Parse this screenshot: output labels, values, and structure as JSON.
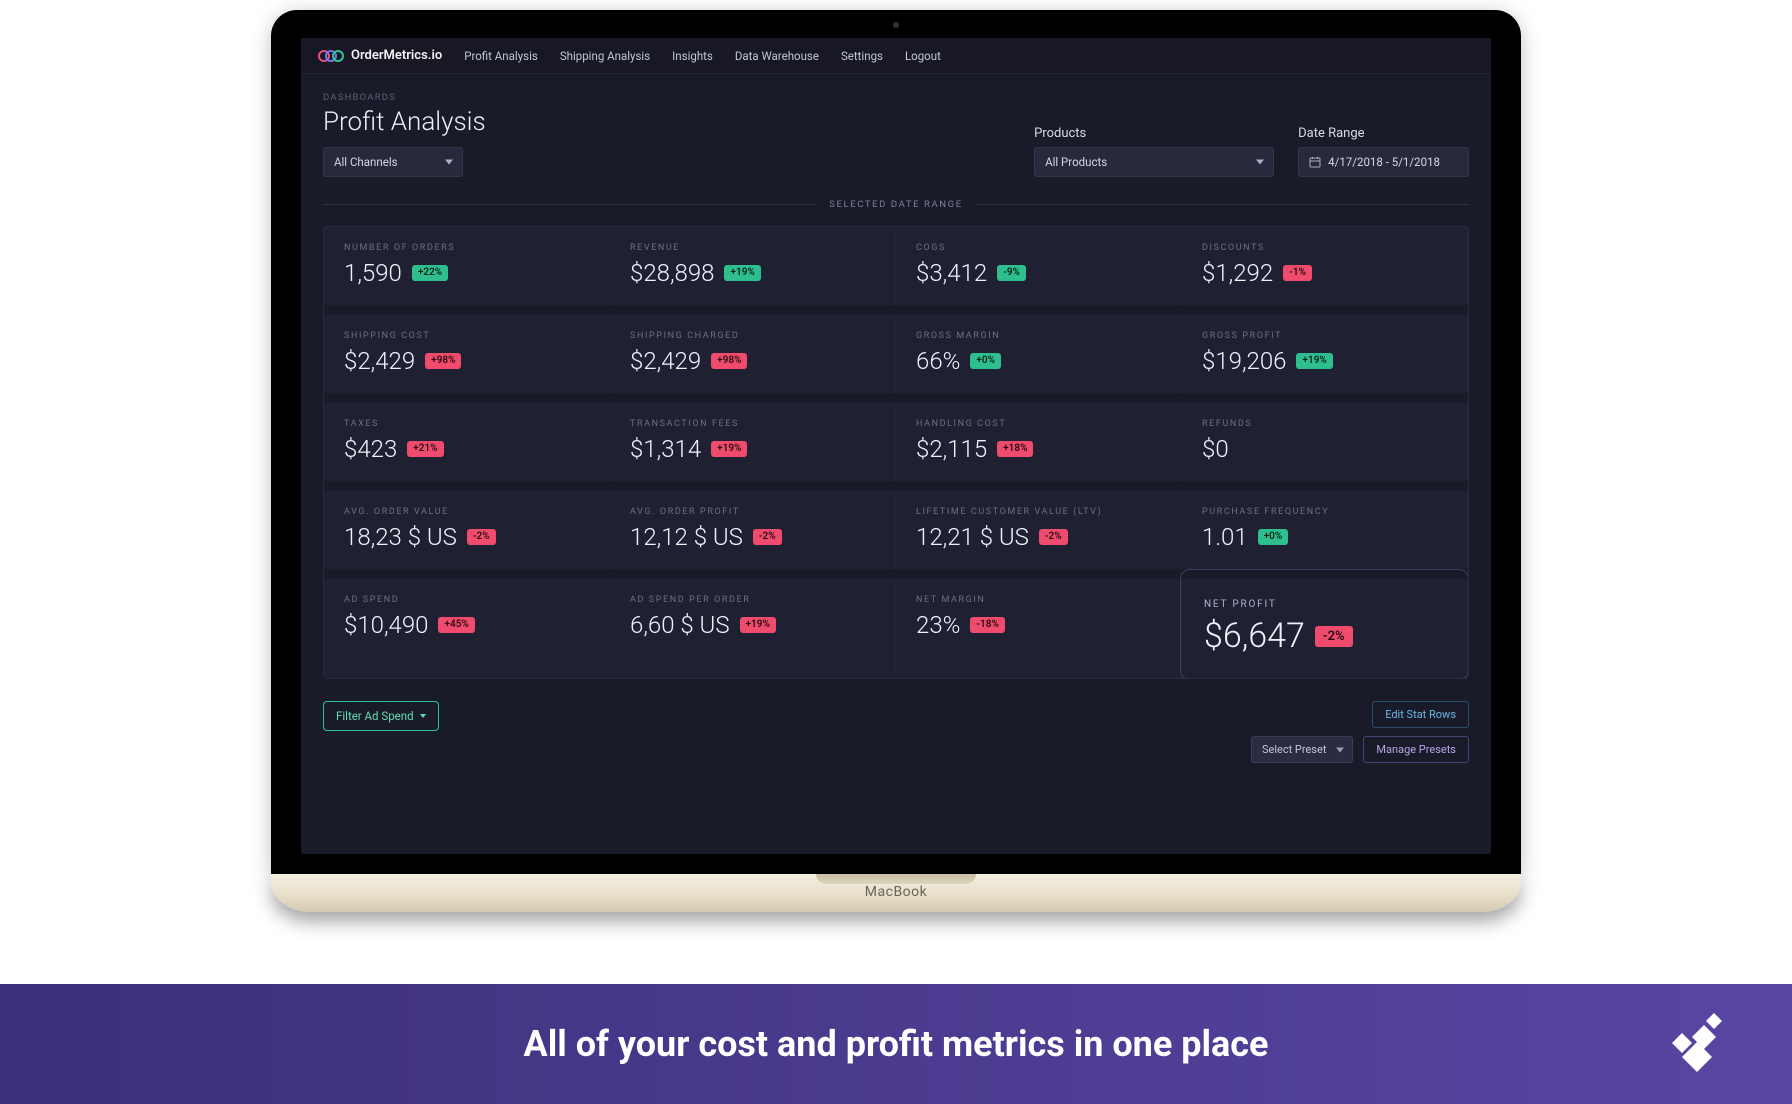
{
  "brand": {
    "name": "OrderMetrics.io",
    "laptop": "MacBook"
  },
  "nav": {
    "items": [
      {
        "label": "Profit Analysis"
      },
      {
        "label": "Shipping Analysis"
      },
      {
        "label": "Insights"
      },
      {
        "label": "Data Warehouse"
      },
      {
        "label": "Settings"
      },
      {
        "label": "Logout"
      }
    ]
  },
  "header": {
    "breadcrumb": "DASHBOARDS",
    "title": "Profit Analysis",
    "channel_select": "All Channels",
    "products_label": "Products",
    "products_select": "All Products",
    "date_label": "Date Range",
    "date_value": "4/17/2018 - 5/1/2018"
  },
  "divider": "SELECTED DATE RANGE",
  "metrics": [
    [
      {
        "label": "Number of Orders",
        "value": "1,590",
        "delta": "+22%",
        "dir": "up"
      },
      {
        "label": "Revenue",
        "value": "$28,898",
        "delta": "+19%",
        "dir": "up"
      },
      {
        "label": "COGS",
        "value": "$3,412",
        "delta": "-9%",
        "dir": "up"
      },
      {
        "label": "Discounts",
        "value": "$1,292",
        "delta": "-1%",
        "dir": "down"
      }
    ],
    [
      {
        "label": "Shipping Cost",
        "value": "$2,429",
        "delta": "+98%",
        "dir": "down"
      },
      {
        "label": "Shipping Charged",
        "value": "$2,429",
        "delta": "+98%",
        "dir": "down"
      },
      {
        "label": "Gross Margin",
        "value": "66%",
        "delta": "+0%",
        "dir": "up"
      },
      {
        "label": "Gross Profit",
        "value": "$19,206",
        "delta": "+19%",
        "dir": "up"
      }
    ],
    [
      {
        "label": "Taxes",
        "value": "$423",
        "delta": "+21%",
        "dir": "down"
      },
      {
        "label": "Transaction Fees",
        "value": "$1,314",
        "delta": "+19%",
        "dir": "down"
      },
      {
        "label": "Handling Cost",
        "value": "$2,115",
        "delta": "+18%",
        "dir": "down"
      },
      {
        "label": "Refunds",
        "value": "$0",
        "delta": "",
        "dir": ""
      }
    ],
    [
      {
        "label": "Avg. Order Value",
        "value": "18,23 $ US",
        "delta": "-2%",
        "dir": "down"
      },
      {
        "label": "Avg. Order Profit",
        "value": "12,12 $ US",
        "delta": "-2%",
        "dir": "down"
      },
      {
        "label": "Lifetime Customer Value (LTV)",
        "value": "12,21 $ US",
        "delta": "-2%",
        "dir": "down"
      },
      {
        "label": "Purchase Frequency",
        "value": "1.01",
        "delta": "+0%",
        "dir": "up"
      }
    ],
    [
      {
        "label": "Ad Spend",
        "value": "$10,490",
        "delta": "+45%",
        "dir": "down"
      },
      {
        "label": "Ad Spend Per Order",
        "value": "6,60 $ US",
        "delta": "+19%",
        "dir": "down"
      },
      {
        "label": "Net Margin",
        "value": "23%",
        "delta": "-18%",
        "dir": "down"
      },
      {
        "label": "Net Profit",
        "value": "$6,647",
        "delta": "-2%",
        "dir": "down",
        "highlight": true
      }
    ]
  ],
  "actions": {
    "filter_ad_spend": "Filter Ad Spend",
    "edit_stat_rows": "Edit Stat Rows",
    "manage_presets": "Manage Presets",
    "select_preset": "Select Preset"
  },
  "banner": {
    "text": "All of your cost and profit metrics in one place"
  }
}
